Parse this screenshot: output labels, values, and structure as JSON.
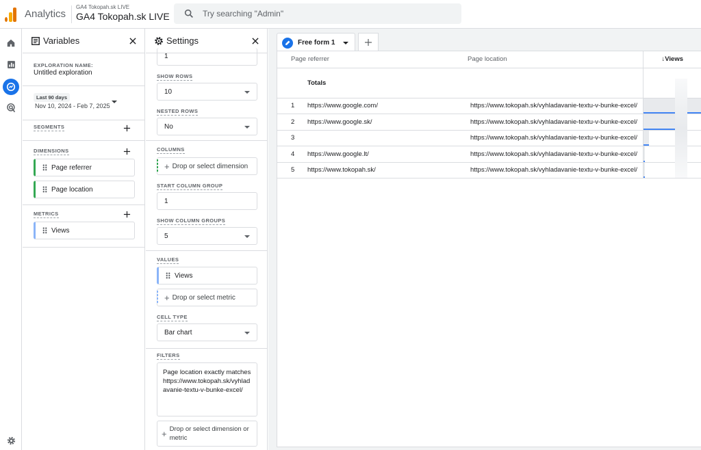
{
  "topbar": {
    "app_name": "Analytics",
    "account_small": "GA4 Tokopah.sk LIVE",
    "account_large": "GA4 Tokopah.sk LIVE",
    "search_placeholder": "Try searching \"Admin\""
  },
  "rail": {
    "icons": [
      "home-icon",
      "reports-icon",
      "explore-icon",
      "advertising-icon",
      "settings-icon"
    ],
    "active": "explore-icon",
    "accent": "#1a73e8"
  },
  "variables": {
    "title": "Variables",
    "exploration_name_label": "EXPLORATION NAME:",
    "exploration_name": "Untitled exploration",
    "date_badge": "Last 90 days",
    "date_range": "Nov 10, 2024 - Feb 7, 2025",
    "segments_label": "SEGMENTS",
    "dimensions_label": "DIMENSIONS",
    "dimensions": [
      "Page referrer",
      "Page location"
    ],
    "metrics_label": "METRICS",
    "metrics": [
      "Views"
    ]
  },
  "settings": {
    "title": "Settings",
    "start_row_value": "1",
    "show_rows_label": "SHOW ROWS",
    "show_rows_value": "10",
    "nested_rows_label": "NESTED ROWS",
    "nested_rows_value": "No",
    "columns_label": "COLUMNS",
    "columns_drop": "Drop or select dimension",
    "start_column_group_label": "START COLUMN GROUP",
    "start_column_group_value": "1",
    "show_column_groups_label": "SHOW COLUMN GROUPS",
    "show_column_groups_value": "5",
    "values_label": "VALUES",
    "values_item": "Views",
    "values_drop": "Drop or select metric",
    "cell_type_label": "CELL TYPE",
    "cell_type_value": "Bar chart",
    "filters_label": "FILTERS",
    "filter_text": "Page location exactly matches https://www.tokopah.sk/vyhladavanie-textu-v-bunke-excel/",
    "filter_drop": "Drop or select dimension or metric"
  },
  "canvas": {
    "tab_label": "Free form 1",
    "columns": [
      "Page referrer",
      "Page location",
      "Views"
    ],
    "totals_label": "Totals",
    "rows": [
      {
        "idx": "1",
        "ref": "https://www.google.com/",
        "loc": "https://www.tokopah.sk/vyhladavanie-textu-v-bunke-excel/",
        "views_fraction": 1.0
      },
      {
        "idx": "2",
        "ref": "https://www.google.sk/",
        "loc": "https://www.tokopah.sk/vyhladavanie-textu-v-bunke-excel/",
        "views_fraction": 0.55
      },
      {
        "idx": "3",
        "ref": "",
        "loc": "https://www.tokopah.sk/vyhladavanie-textu-v-bunke-excel/",
        "views_fraction": 0.1
      },
      {
        "idx": "4",
        "ref": "https://www.google.lt/",
        "loc": "https://www.tokopah.sk/vyhladavanie-textu-v-bunke-excel/",
        "views_fraction": 0.03
      },
      {
        "idx": "5",
        "ref": "https://www.tokopah.sk/",
        "loc": "https://www.tokopah.sk/vyhladavanie-textu-v-bunke-excel/",
        "views_fraction": 0.03
      }
    ]
  }
}
